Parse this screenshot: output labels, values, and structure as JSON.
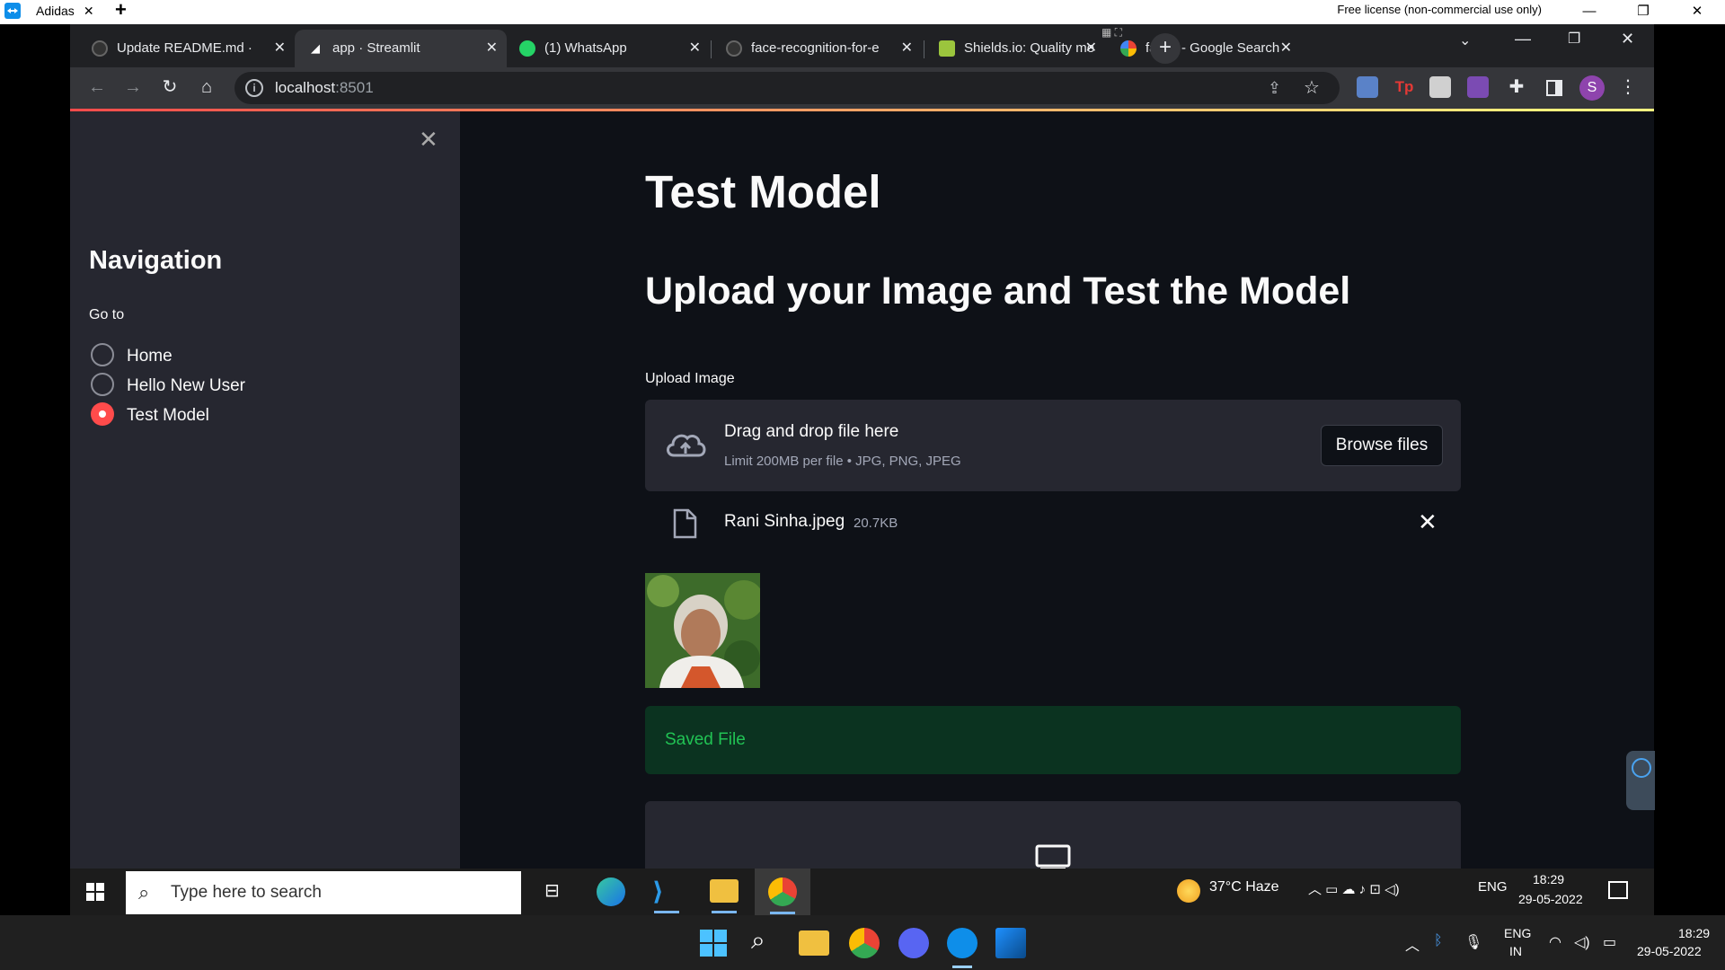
{
  "outer": {
    "tab_label": "Adidas",
    "tab_close": "✕",
    "new_tab": "+",
    "license": "Free license (non-commercial use only)",
    "minimize": "—",
    "restore": "❐",
    "close": "✕"
  },
  "browser": {
    "tabs": [
      {
        "label": "Update README.md ·",
        "icon": "github-icon"
      },
      {
        "label": "app · Streamlit",
        "icon": "streamlit-icon"
      },
      {
        "label": "(1) WhatsApp",
        "icon": "whatsapp-icon"
      },
      {
        "label": "face-recognition-for-e",
        "icon": "github-icon"
      },
      {
        "label": "Shields.io: Quality me",
        "icon": "shields-icon"
      },
      {
        "label": "faces - Google Search",
        "icon": "google-icon"
      }
    ],
    "tab_close": "✕",
    "new_tab": "+",
    "url_host": "localhost",
    "url_port": ":8501"
  },
  "sidebar": {
    "close": "✕",
    "title": "Navigation",
    "goto_label": "Go to",
    "options": [
      "Home",
      "Hello New User",
      "Test Model"
    ],
    "selected_index": 2
  },
  "main": {
    "menu": "☰",
    "title": "Test Model",
    "subtitle": "Upload your Image and Test the Model",
    "upload_label": "Upload Image",
    "dropzone_title": "Drag and drop file here",
    "dropzone_limit": "Limit 200MB per file • JPG, PNG, JPEG",
    "browse_button": "Browse files",
    "file_name": "Rani Sinha.jpeg",
    "file_size": "20.7KB",
    "file_remove": "✕",
    "success_message": "Saved File"
  },
  "remote_taskbar": {
    "search_placeholder": "Type here to search",
    "weather": "37°C  Haze",
    "lang": "ENG",
    "time": "18:29",
    "date": "29-05-2022"
  },
  "host_taskbar": {
    "lang_line1": "ENG",
    "lang_line2": "IN",
    "time": "18:29",
    "date": "29-05-2022"
  },
  "colors": {
    "streamlit_red": "#ff4b4b",
    "success_green": "#21c354",
    "sidebar_bg": "#262730",
    "main_bg": "#0e1117"
  }
}
